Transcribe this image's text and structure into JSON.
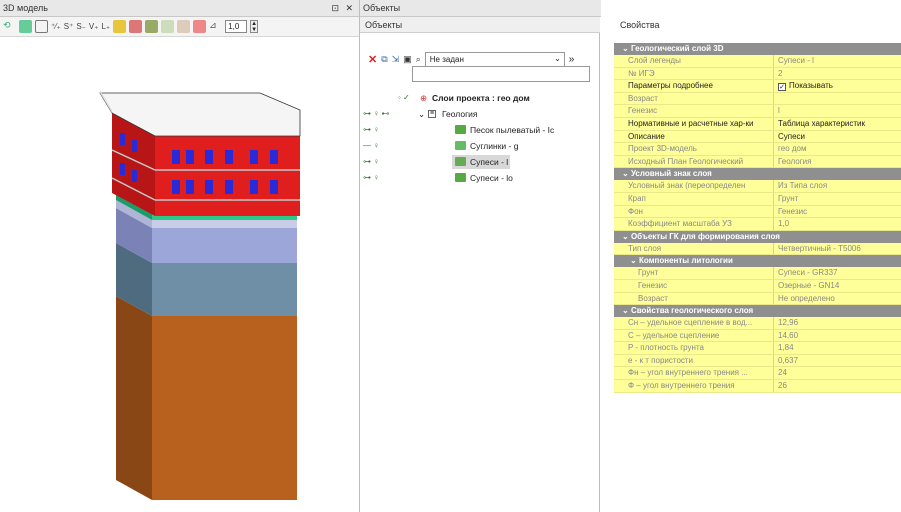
{
  "panels": {
    "model3d_title": "3D модель",
    "objects_window_title": "Объекты",
    "objects_subtitle": "Объекты",
    "properties_subtitle": "Свойства"
  },
  "toolbar3d": {
    "scale_value": "1,0"
  },
  "objects": {
    "filter_value": "Не задан",
    "tree": [
      {
        "label": "Слои проекта : гео дом",
        "bold": true,
        "icon": "layers-icon"
      },
      {
        "label": "Геология",
        "icon": "folder-icon"
      },
      {
        "label": "Песок пылеватый - Iс",
        "icon": "layer-icon"
      },
      {
        "label": "Суглинки - g",
        "icon": "layer-icon"
      },
      {
        "label": "Супеси - l",
        "icon": "layer-icon",
        "selected": true
      },
      {
        "label": "Супеси - lo",
        "icon": "layer-icon"
      }
    ]
  },
  "properties": {
    "groups": [
      {
        "title": "Геологический слой 3D",
        "rows": [
          {
            "name": "Слой легенды",
            "value": "Супеси - l",
            "active": false
          },
          {
            "name": "№ ИГЭ",
            "value": "2",
            "active": false
          },
          {
            "name": "Параметры подробнее",
            "value": "Показывать",
            "checkbox": true,
            "active": true
          },
          {
            "name": "Возраст",
            "value": "",
            "active": false
          },
          {
            "name": "Генезис",
            "value": "l",
            "active": false
          },
          {
            "name": "Нормативные и расчетные хар-ки",
            "value": "Таблица характеристик",
            "active": true
          },
          {
            "name": "Описание",
            "value": "Супеси",
            "active": true
          },
          {
            "name": "Проект 3D-модель",
            "value": "гео дом",
            "active": false
          },
          {
            "name": "Исходный План Геологический",
            "value": "Геология",
            "active": false
          }
        ]
      },
      {
        "title": "Условный знак слоя",
        "rows": [
          {
            "name": "Условный знак (переопределен",
            "value": "Из Типа слоя",
            "active": false
          },
          {
            "name": "Крап",
            "value": "Грунт",
            "active": false
          },
          {
            "name": "Фон",
            "value": "Генезис",
            "active": false
          },
          {
            "name": "Коэффициент масштаба УЗ",
            "value": "1,0",
            "active": false
          }
        ]
      },
      {
        "title": "Объекты ГК для формирования слоя",
        "rows": [
          {
            "name": "Тип слоя",
            "value": "Четвертичный - Т5006",
            "active": false
          }
        ]
      },
      {
        "title": "Компоненты литологии",
        "sub": true,
        "rows": [
          {
            "name": "Грунт",
            "value": "Супеси - GR337",
            "active": false,
            "sub": true
          },
          {
            "name": "Генезис",
            "value": "Озерные - GN14",
            "active": false,
            "sub": true
          },
          {
            "name": "Возраст",
            "value": "Не определено",
            "active": false,
            "sub": true
          }
        ]
      },
      {
        "title": "Свойства геологического слоя",
        "rows": [
          {
            "name": "Сн – удельное сцепление в вод...",
            "value": "12,96",
            "active": false
          },
          {
            "name": "С – удельное сцепление",
            "value": "14,60",
            "active": false
          },
          {
            "name": "P - плотность грунта",
            "value": "1,84",
            "active": false
          },
          {
            "name": "е - к т пористости",
            "value": "0,637",
            "active": false
          },
          {
            "name": "Фн – угол внутреннего трения ...",
            "value": "24",
            "active": false
          },
          {
            "name": "Ф – угол внутреннего трения",
            "value": "26",
            "active": false
          }
        ]
      }
    ]
  },
  "colors": {
    "property_bg": "#ffff99",
    "group_header": "#8f8f8f",
    "building_wall": "#e01e1e",
    "window": "#2a2ad8",
    "layer_green": "#2cc98a",
    "layer_lavender": "#9da6d8",
    "layer_steel": "#6f8fa6",
    "layer_brown": "#b8611f"
  }
}
